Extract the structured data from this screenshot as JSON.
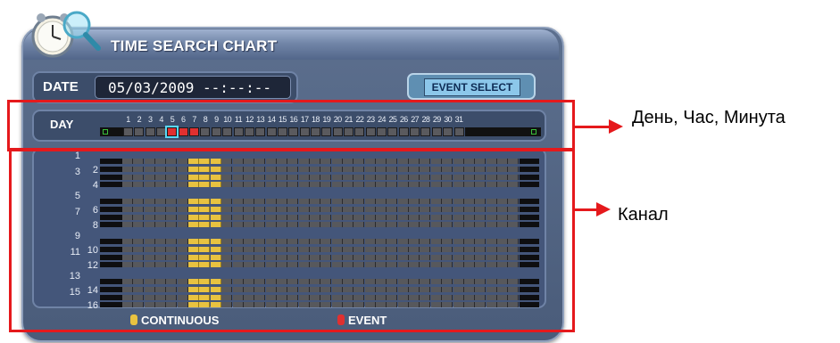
{
  "title": "TIME SEARCH CHART",
  "date_label": "DATE",
  "date_value": "05/03/2009 --:--:--",
  "event_select_label": "EVENT SELECT",
  "day_label": "DAY",
  "days": [
    "1",
    "2",
    "3",
    "4",
    "5",
    "6",
    "7",
    "8",
    "9",
    "10",
    "11",
    "12",
    "13",
    "14",
    "15",
    "16",
    "17",
    "18",
    "19",
    "20",
    "21",
    "22",
    "23",
    "24",
    "25",
    "26",
    "27",
    "28",
    "29",
    "30",
    "31"
  ],
  "selected_day": "5",
  "days_with_continuous": [
    "5",
    "6",
    "7"
  ],
  "days_with_event": [
    "5",
    "6",
    "7"
  ],
  "channel_labels": [
    "1",
    "2",
    "3",
    "4",
    "5",
    "6",
    "7",
    "8",
    "9",
    "10",
    "11",
    "12",
    "13",
    "14",
    "15",
    "16"
  ],
  "legend": {
    "continuous_label": "CONTINUOUS",
    "event_label": "EVENT",
    "continuous_color": "#e8c240",
    "event_color": "#e03030"
  },
  "annotations": {
    "day_hour_minute": "День, Час, Минута",
    "channel": "Канал"
  },
  "annotation_color": "#e5191c",
  "icons": [
    "clock-magnifier-icon",
    "legend-continuous-icon",
    "legend-event-icon"
  ]
}
